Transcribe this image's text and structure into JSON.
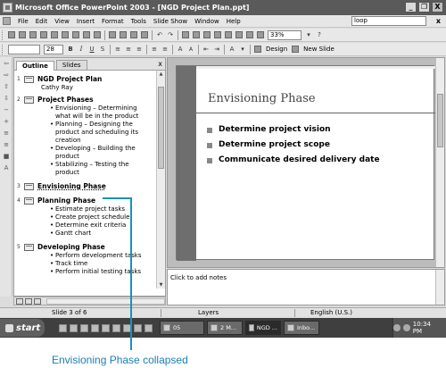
{
  "window": {
    "title": "Microsoft Office PowerPoint 2003 - [NGD Project Plan.ppt]",
    "minimize": "_",
    "restore": "❐",
    "close": "X"
  },
  "menubar": {
    "items": [
      "File",
      "Edit",
      "View",
      "Insert",
      "Format",
      "Tools",
      "Slide Show",
      "Window",
      "Help"
    ],
    "help_box_value": "loop",
    "doc_close": "x"
  },
  "toolbar": {
    "zoom": "33%",
    "font_size": "28",
    "bold": "B",
    "italic": "I",
    "underline": "U",
    "shadow": "S",
    "increase_font": "A",
    "decrease_font": "A",
    "design_label": "Design",
    "new_slide_label": "New Slide"
  },
  "outline_pane": {
    "tabs": [
      "Outline",
      "Slides"
    ],
    "close": "x",
    "slides": [
      {
        "num": "1",
        "title": "NGD Project Plan",
        "sub": "Cathy Ray",
        "bullets": []
      },
      {
        "num": "2",
        "title": "Project Phases",
        "bullets": [
          "Envisioning – Determining what will be in the product",
          "Planning – Designing the product and scheduling its creation",
          "Developing – Building the product",
          "Stabilizing – Testing the product"
        ]
      },
      {
        "num": "3",
        "title": "Envisioning Phase",
        "bullets": []
      },
      {
        "num": "4",
        "title": "Planning Phase",
        "bullets": [
          "Estimate project tasks",
          "Create project schedule",
          "Determine exit criteria",
          "Gantt chart"
        ]
      },
      {
        "num": "5",
        "title": "Developing Phase",
        "bullets": [
          "Perform development tasks",
          "Track time",
          "Perform initial testing tasks"
        ]
      }
    ]
  },
  "slide": {
    "title": "Envisioning Phase",
    "bullets": [
      "Determine project vision",
      "Determine project scope",
      "Communicate desired delivery date"
    ]
  },
  "notes": {
    "placeholder": "Click to add notes"
  },
  "statusbar": {
    "slide_position": "Slide 3 of 6",
    "design_name": "Layers",
    "language": "English (U.S.)"
  },
  "taskbar": {
    "start": "start",
    "tasks": [
      "05",
      "2 M...",
      "NGD ...",
      "Inbo..."
    ],
    "clock": "10:34 PM"
  },
  "callout": {
    "text": "Envisioning Phase collapsed",
    "color": "#1793b8"
  }
}
